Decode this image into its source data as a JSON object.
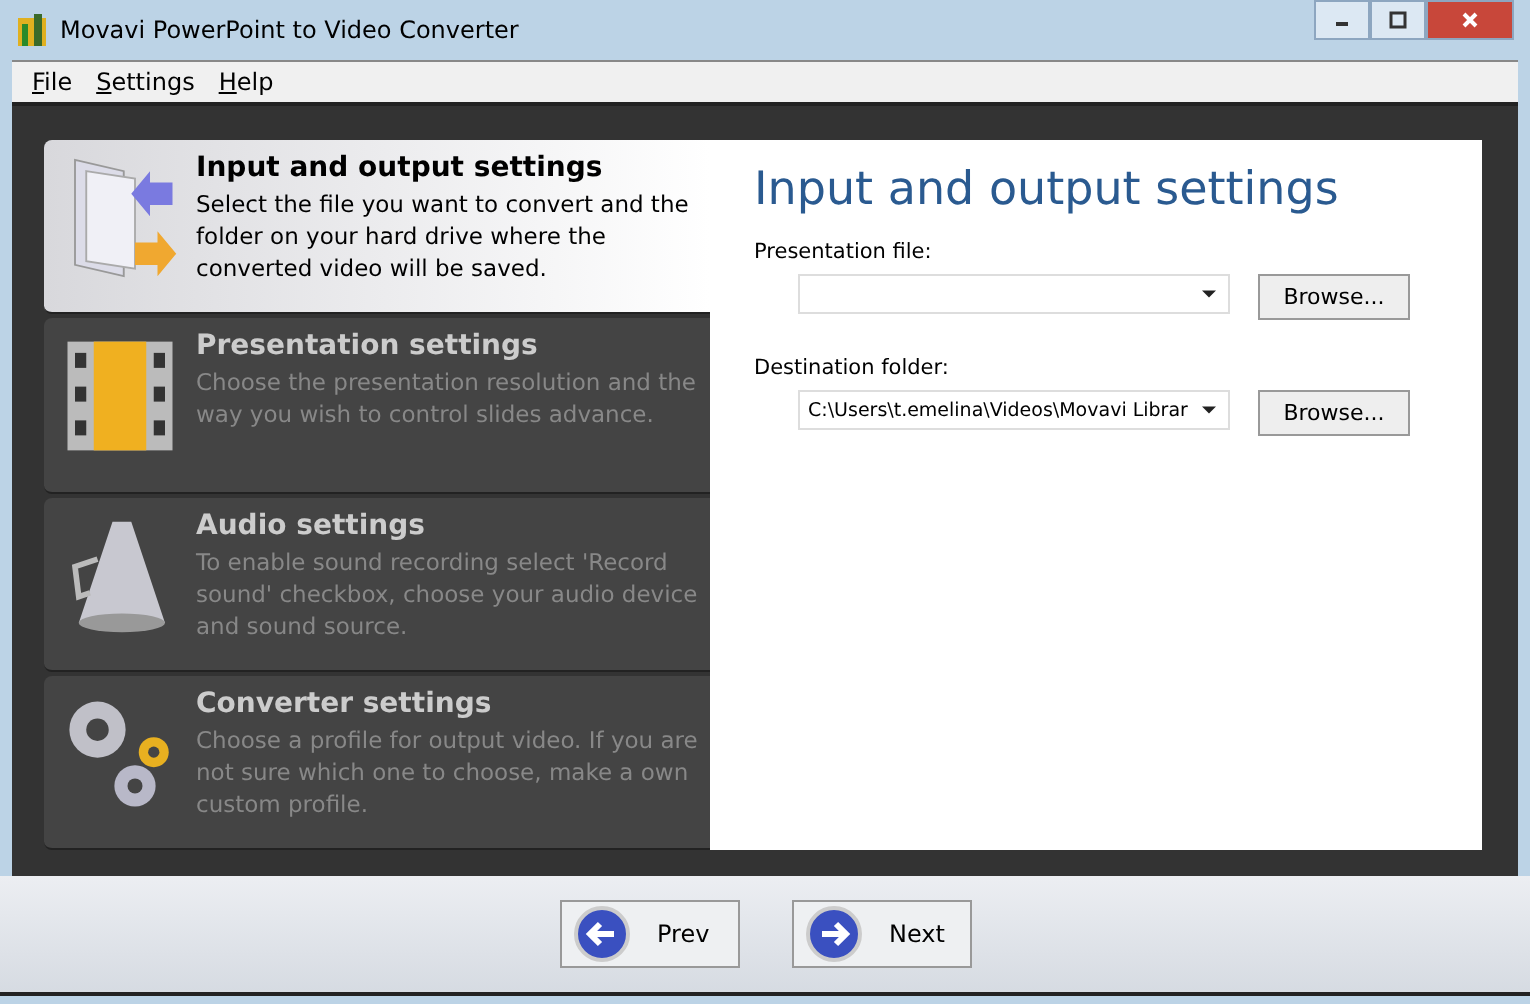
{
  "window": {
    "title": "Movavi PowerPoint to Video Converter"
  },
  "menu": [
    "File",
    "Settings",
    "Help"
  ],
  "sections": [
    {
      "title": "Input and output settings",
      "description": "Select the file you want to convert and the folder on your hard drive where the converted video will be saved.",
      "selected": true
    },
    {
      "title": "Presentation settings",
      "description": "Choose the presentation resolution and the way you wish to control slides advance.",
      "selected": false
    },
    {
      "title": "Audio settings",
      "description": "To enable sound recording select 'Record sound' checkbox, choose your audio device and sound source.",
      "selected": false
    },
    {
      "title": "Converter settings",
      "description": "Choose a profile for output video. If you are not sure which one to choose, make a own custom profile.",
      "selected": false
    }
  ],
  "panel": {
    "heading": "Input and output settings",
    "fields": [
      {
        "label": "Presentation file:",
        "button": "Browse..."
      },
      {
        "label": "Destination folder:",
        "value": "C:\\Users\\t.emelina\\Videos\\Movavi Librar",
        "button": "Browse..."
      }
    ]
  },
  "nav": [
    "Prev",
    "Next"
  ]
}
